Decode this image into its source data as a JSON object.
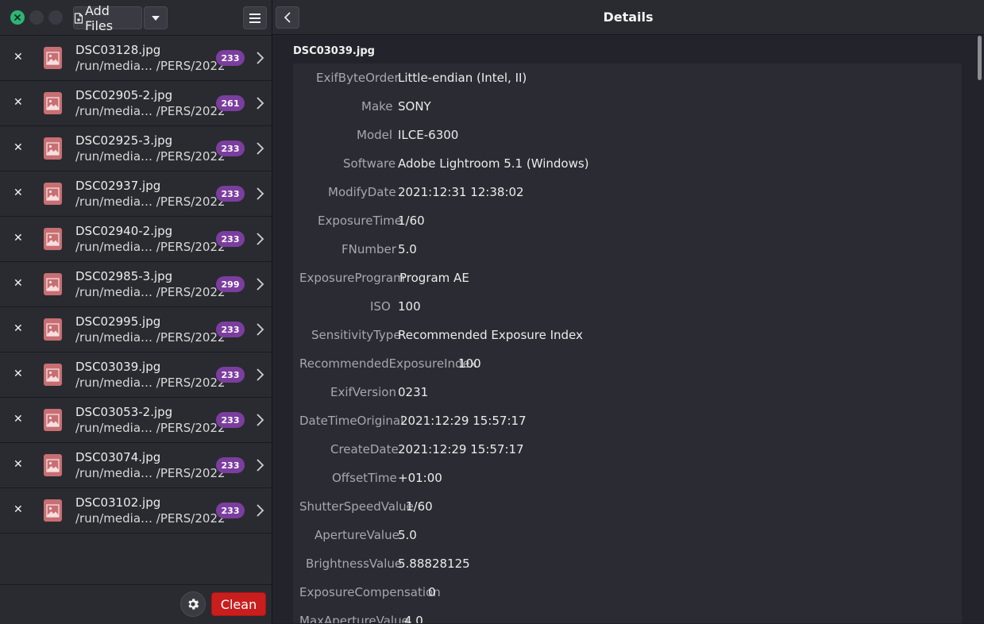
{
  "toolbar": {
    "add_files_label": "Add Files",
    "details_title": "Details",
    "clean_label": "Clean"
  },
  "files": [
    {
      "name": "DSC03128.jpg",
      "path": "/run/media…  /PERS/2022",
      "count": "233"
    },
    {
      "name": "DSC02905-2.jpg",
      "path": "/run/media…  /PERS/2022",
      "count": "261"
    },
    {
      "name": "DSC02925-3.jpg",
      "path": "/run/media…  /PERS/2022",
      "count": "233"
    },
    {
      "name": "DSC02937.jpg",
      "path": "/run/media…  /PERS/2022",
      "count": "233"
    },
    {
      "name": "DSC02940-2.jpg",
      "path": "/run/media…  /PERS/2022",
      "count": "233"
    },
    {
      "name": "DSC02985-3.jpg",
      "path": "/run/media…  /PERS/2022",
      "count": "299"
    },
    {
      "name": "DSC02995.jpg",
      "path": "/run/media…  /PERS/2022",
      "count": "233"
    },
    {
      "name": "DSC03039.jpg",
      "path": "/run/media…  /PERS/2022",
      "count": "233"
    },
    {
      "name": "DSC03053-2.jpg",
      "path": "/run/media…  /PERS/2022",
      "count": "233"
    },
    {
      "name": "DSC03074.jpg",
      "path": "/run/media…  /PERS/2022",
      "count": "233"
    },
    {
      "name": "DSC03102.jpg",
      "path": "/run/media…  /PERS/2022",
      "count": "233"
    }
  ],
  "details": {
    "filename": "DSC03039.jpg",
    "metadata": [
      {
        "key": "ExifByteOrder",
        "value": "Little-endian (Intel, II)"
      },
      {
        "key": "Make",
        "value": "SONY"
      },
      {
        "key": "Model",
        "value": "ILCE-6300"
      },
      {
        "key": "Software",
        "value": "Adobe Lightroom 5.1 (Windows)"
      },
      {
        "key": "ModifyDate",
        "value": "2021:12:31 12:38:02"
      },
      {
        "key": "ExposureTime",
        "value": "1/60"
      },
      {
        "key": "FNumber",
        "value": "5.0"
      },
      {
        "key": "ExposureProgram",
        "value": "Program AE"
      },
      {
        "key": "ISO",
        "value": "100"
      },
      {
        "key": "SensitivityType",
        "value": "Recommended Exposure Index"
      },
      {
        "key": "RecommendedExposureIndex",
        "value": "100"
      },
      {
        "key": "ExifVersion",
        "value": "0231"
      },
      {
        "key": "DateTimeOriginal",
        "value": "2021:12:29 15:57:17"
      },
      {
        "key": "CreateDate",
        "value": "2021:12:29 15:57:17"
      },
      {
        "key": "OffsetTime",
        "value": "+01:00"
      },
      {
        "key": "ShutterSpeedValue",
        "value": "1/60"
      },
      {
        "key": "ApertureValue",
        "value": "5.0"
      },
      {
        "key": "BrightnessValue",
        "value": "5.88828125"
      },
      {
        "key": "ExposureCompensation",
        "value": "0"
      },
      {
        "key": "MaxApertureValue",
        "value": "4.0"
      }
    ]
  },
  "icons": {
    "close": "close-icon",
    "minimize": "minimize-icon",
    "maximize": "maximize-icon",
    "add_file": "file-add-icon",
    "dropdown": "chevron-down-icon",
    "menu": "hamburger-menu-icon",
    "remove": "close-x-icon",
    "thumbnail": "image-icon",
    "chevron": "chevron-right-icon",
    "gear": "gear-icon",
    "back": "chevron-left-icon"
  },
  "colors": {
    "badge": "#7b3e9e",
    "clean": "#c91e1e",
    "close_window": "#2bb673",
    "thumbnail": "#c76f73"
  }
}
